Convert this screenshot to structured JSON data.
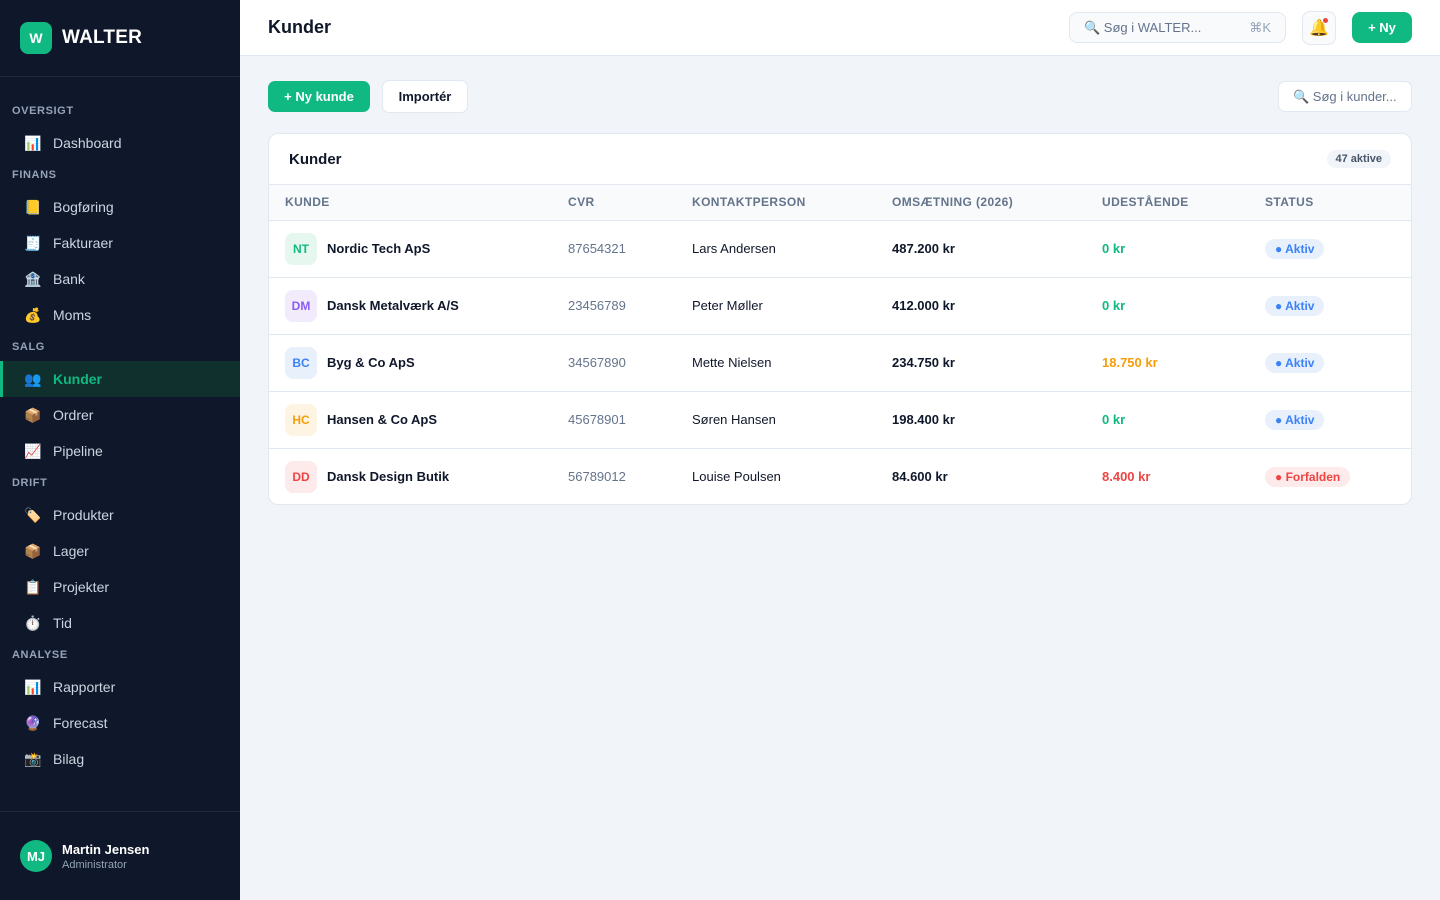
{
  "brand": {
    "logo_letter": "W",
    "name": "WALTER"
  },
  "sidebar": {
    "sections": [
      {
        "label": "OVERSIGT",
        "items": [
          {
            "icon": "📊",
            "icon_name": "dashboard-icon",
            "label": "Dashboard"
          }
        ]
      },
      {
        "label": "FINANS",
        "items": [
          {
            "icon": "📒",
            "icon_name": "ledger-icon",
            "label": "Bogføring"
          },
          {
            "icon": "🧾",
            "icon_name": "invoice-icon",
            "label": "Fakturaer"
          },
          {
            "icon": "🏦",
            "icon_name": "bank-icon",
            "label": "Bank"
          },
          {
            "icon": "💰",
            "icon_name": "money-bag-icon",
            "label": "Moms"
          }
        ]
      },
      {
        "label": "SALG",
        "items": [
          {
            "icon": "👥",
            "icon_name": "customers-icon",
            "label": "Kunder",
            "active": true
          },
          {
            "icon": "📦",
            "icon_name": "package-icon",
            "label": "Ordrer"
          },
          {
            "icon": "📈",
            "icon_name": "trend-chart-icon",
            "label": "Pipeline"
          }
        ]
      },
      {
        "label": "DRIFT",
        "items": [
          {
            "icon": "🏷️",
            "icon_name": "tag-icon",
            "label": "Produkter"
          },
          {
            "icon": "📦",
            "icon_name": "package-icon",
            "label": "Lager"
          },
          {
            "icon": "📋",
            "icon_name": "clipboard-icon",
            "label": "Projekter"
          },
          {
            "icon": "⏱️",
            "icon_name": "stopwatch-icon",
            "label": "Tid"
          }
        ]
      },
      {
        "label": "ANALYSE",
        "items": [
          {
            "icon": "📊",
            "icon_name": "bar-chart-icon",
            "label": "Rapporter"
          },
          {
            "icon": "🔮",
            "icon_name": "crystal-ball-icon",
            "label": "Forecast"
          },
          {
            "icon": "📸",
            "icon_name": "camera-icon",
            "label": "Bilag"
          }
        ]
      }
    ]
  },
  "user": {
    "initials": "MJ",
    "name": "Martin Jensen",
    "role": "Administrator"
  },
  "topbar": {
    "title": "Kunder",
    "search_placeholder": "🔍 Søg i WALTER...",
    "search_shortcut": "⌘K",
    "bell_icon": "🔔",
    "new_label": "+ Ny"
  },
  "toolbar": {
    "new_customer_label": "+ Ny kunde",
    "import_label": "Importér",
    "search_placeholder": "🔍 Søg i kunder..."
  },
  "table": {
    "title": "Kunder",
    "count_badge": "47 aktive",
    "columns": [
      "Kunde",
      "CVR",
      "Kontaktperson",
      "Omsætning (2026)",
      "Udestående",
      "Status"
    ],
    "rows": [
      {
        "initials": "NT",
        "av_bg": "#e6f7f0",
        "av_fg": "#10b981",
        "name": "Nordic Tech ApS",
        "cvr": "87654321",
        "contact": "Lars Andersen",
        "revenue": "487.200 kr",
        "outstanding": "0 kr",
        "outstanding_color": "#10b981",
        "status": "● Aktiv",
        "status_bg": "#e8f0fc",
        "status_fg": "#3b82f6"
      },
      {
        "initials": "DM",
        "av_bg": "#f1ebfb",
        "av_fg": "#8b5cf6",
        "name": "Dansk Metalværk A/S",
        "cvr": "23456789",
        "contact": "Peter Møller",
        "revenue": "412.000 kr",
        "outstanding": "0 kr",
        "outstanding_color": "#10b981",
        "status": "● Aktiv",
        "status_bg": "#e8f0fc",
        "status_fg": "#3b82f6"
      },
      {
        "initials": "BC",
        "av_bg": "#e8f0fc",
        "av_fg": "#3b82f6",
        "name": "Byg & Co ApS",
        "cvr": "34567890",
        "contact": "Mette Nielsen",
        "revenue": "234.750 kr",
        "outstanding": "18.750 kr",
        "outstanding_color": "#f59e0b",
        "status": "● Aktiv",
        "status_bg": "#e8f0fc",
        "status_fg": "#3b82f6"
      },
      {
        "initials": "HC",
        "av_bg": "#fdf4e3",
        "av_fg": "#f59e0b",
        "name": "Hansen & Co ApS",
        "cvr": "45678901",
        "contact": "Søren Hansen",
        "revenue": "198.400 kr",
        "outstanding": "0 kr",
        "outstanding_color": "#10b981",
        "status": "● Aktiv",
        "status_bg": "#e8f0fc",
        "status_fg": "#3b82f6"
      },
      {
        "initials": "DD",
        "av_bg": "#fdeaea",
        "av_fg": "#ef4444",
        "name": "Dansk Design Butik",
        "cvr": "56789012",
        "contact": "Louise Poulsen",
        "revenue": "84.600 kr",
        "outstanding": "8.400 kr",
        "outstanding_color": "#ef4444",
        "status": "● Forfalden",
        "status_bg": "#fdeaea",
        "status_fg": "#ef4444"
      }
    ]
  }
}
